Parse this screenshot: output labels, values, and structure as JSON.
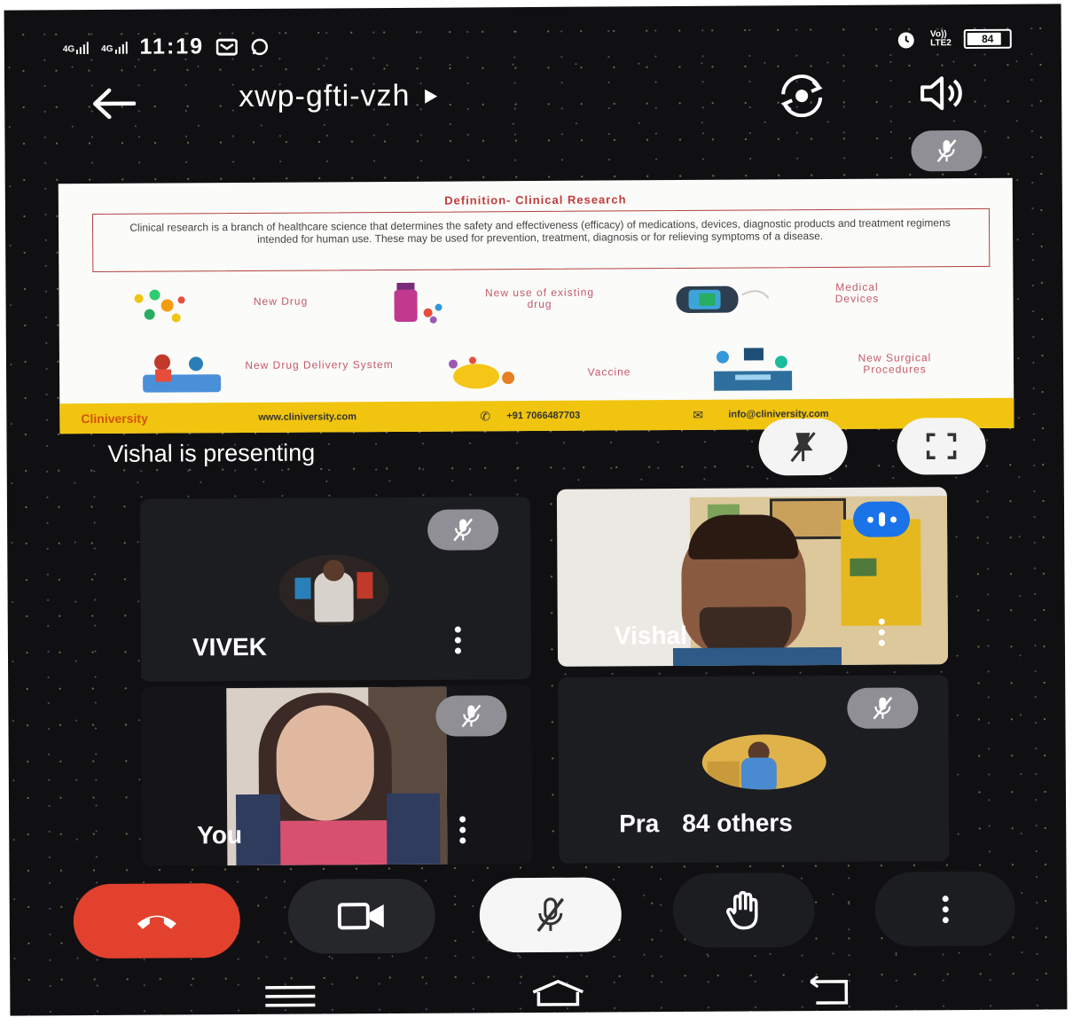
{
  "status_bar": {
    "sig1_top": "4G",
    "sig2_top": "4G",
    "time": "11:19",
    "net_top": "Vo))",
    "net_bottom": "LTE2",
    "battery": "84"
  },
  "top_bar": {
    "meeting_code": "xwp-gfti-vzh"
  },
  "slide": {
    "title": "Definition- Clinical Research",
    "definition": "Clinical research is a branch of healthcare science that determines the safety and effectiveness (efficacy) of medications, devices, diagnostic products and treatment regimens intended for human use. These may be used for prevention, treatment, diagnosis or for relieving symptoms of a disease.",
    "items": [
      {
        "label": "New Drug",
        "icon": "molecule-icon"
      },
      {
        "label": "New use of existing drug",
        "icon": "pill-bottle-icon"
      },
      {
        "label": "Medical Devices",
        "icon": "medical-device-icon"
      },
      {
        "label": "New Drug Delivery System",
        "icon": "drug-delivery-icon"
      },
      {
        "label": "Vaccine",
        "icon": "virus-icon"
      },
      {
        "label": "New Surgical Procedures",
        "icon": "surgery-icon"
      }
    ],
    "footer": {
      "brand": "Cliniversity",
      "website": "www.cliniversity.com",
      "phone": "+91 7066487703",
      "email": "info@cliniversity.com"
    }
  },
  "presenting_text": "Vishal is presenting",
  "participants": [
    {
      "name": "VIVEK",
      "muted": true,
      "video": false
    },
    {
      "name": "Vishal",
      "muted": false,
      "video": true,
      "speaking": true
    },
    {
      "name": "You",
      "muted": true,
      "video": true
    },
    {
      "name": "Pra",
      "others": "84 others",
      "muted": true,
      "video": false
    }
  ],
  "colors": {
    "background": "#101012",
    "end_call": "#e2412e",
    "mute_chip": "#8f8f95",
    "speaking": "#1a73e8",
    "slide_footer": "#f1c40f"
  }
}
